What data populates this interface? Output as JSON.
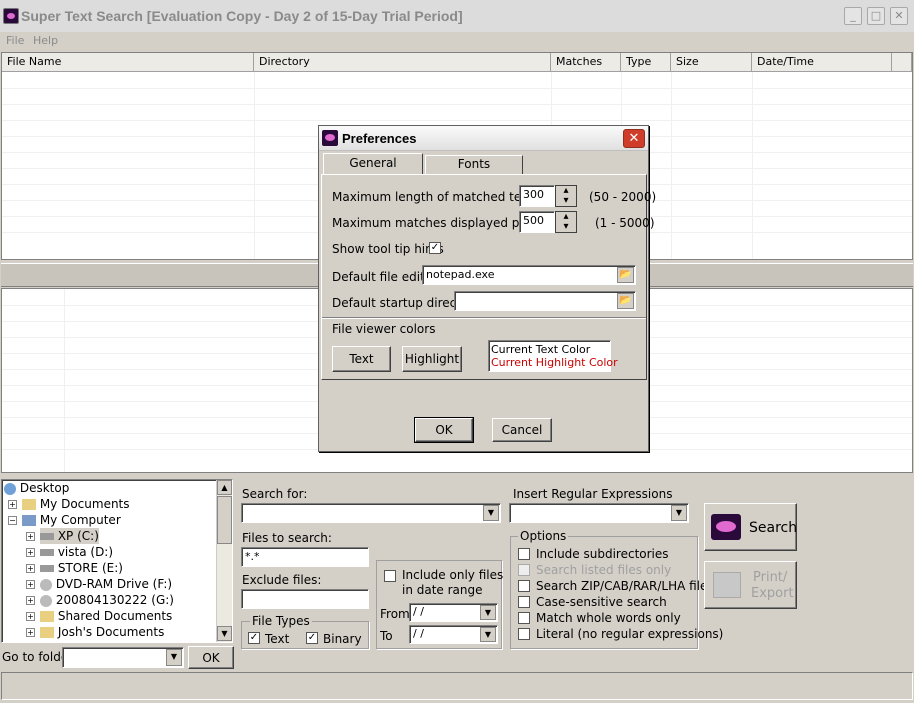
{
  "window": {
    "title": "Super Text Search [Evaluation Copy - Day 2 of 15-Day Trial Period]"
  },
  "menu": [
    "File",
    "Help"
  ],
  "results_columns": [
    "File Name",
    "Directory",
    "Matches",
    "Type",
    "Size",
    "Date/Time"
  ],
  "tree": {
    "items": [
      "Desktop",
      "My Documents",
      "My Computer",
      "XP (C:)",
      "vista (D:)",
      "STORE (E:)",
      "DVD-RAM Drive (F:)",
      "200804130222 (G:)",
      "Shared Documents",
      "Josh's Documents"
    ]
  },
  "goto": {
    "label": "Go to folder",
    "value": "",
    "ok": "OK"
  },
  "search": {
    "search_for_label": "Search for:",
    "search_for_value": "",
    "regex_label": "Insert Regular Expressions",
    "files_label": "Files to search:",
    "files_value": "*.*",
    "exclude_label": "Exclude files:",
    "exclude_value": "",
    "file_types_label": "File Types",
    "type_text": "Text",
    "type_binary": "Binary",
    "date_range_label1": "Include only files",
    "date_range_label2": "in date range",
    "from_label": "From",
    "from_value": " /  /",
    "to_label": "To",
    "to_value": " /  /"
  },
  "options": {
    "label": "Options",
    "items": [
      "Include subdirectories",
      "Search listed files only",
      "Search ZIP/CAB/RAR/LHA files",
      "Case-sensitive search",
      "Match whole words only",
      "Literal (no regular expressions)"
    ]
  },
  "buttons": {
    "search": "Search",
    "print1": "Print/",
    "print2": "Export"
  },
  "dialog": {
    "title": "Preferences",
    "tabs": [
      "General",
      "Fonts"
    ],
    "max_len_label": "Maximum length of matched text",
    "max_len_value": "300",
    "max_len_range": "(50 - 2000)",
    "max_matches_label": "Maximum  matches displayed per file",
    "max_matches_value": "500",
    "max_matches_range": "(1 - 5000)",
    "tooltips_label": "Show tool tip hints",
    "editor_label": "Default file editor",
    "editor_value": "notepad.exe",
    "startup_label": "Default startup directory",
    "startup_value": "",
    "colors_label": "File viewer colors",
    "text_btn": "Text",
    "highlight_btn": "Highlight",
    "current_text": "Current Text Color",
    "current_highlight": "Current Highlight Color",
    "ok": "OK",
    "cancel": "Cancel"
  },
  "colors": {
    "highlight": "#cc0000",
    "titlebar_text": "#8a8a8a"
  }
}
